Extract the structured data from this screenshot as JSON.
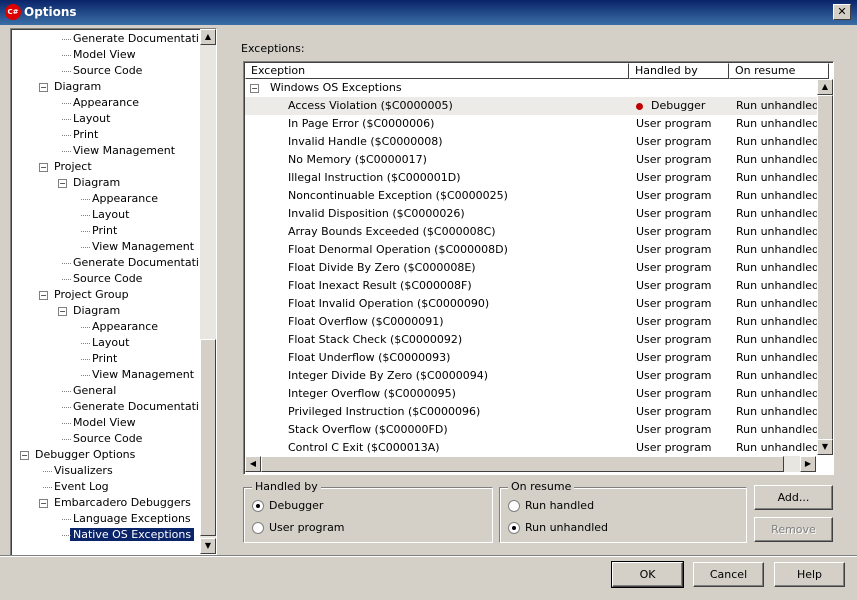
{
  "window": {
    "title": "Options",
    "app_icon_text": "C#"
  },
  "tree": {
    "items": [
      {
        "label": "Generate Documentation",
        "level": 2
      },
      {
        "label": "Model View",
        "level": 2
      },
      {
        "label": "Source Code",
        "level": 2
      },
      {
        "label": "Diagram",
        "level": 1,
        "expander": "-"
      },
      {
        "label": "Appearance",
        "level": 2
      },
      {
        "label": "Layout",
        "level": 2
      },
      {
        "label": "Print",
        "level": 2
      },
      {
        "label": "View Management",
        "level": 2
      },
      {
        "label": "Project",
        "level": 1,
        "expander": "-"
      },
      {
        "label": "Diagram",
        "level": 2,
        "expander": "-"
      },
      {
        "label": "Appearance",
        "level": 3
      },
      {
        "label": "Layout",
        "level": 3
      },
      {
        "label": "Print",
        "level": 3
      },
      {
        "label": "View Management",
        "level": 3
      },
      {
        "label": "Generate Documentation",
        "level": 2
      },
      {
        "label": "Source Code",
        "level": 2
      },
      {
        "label": "Project Group",
        "level": 1,
        "expander": "-"
      },
      {
        "label": "Diagram",
        "level": 2,
        "expander": "-"
      },
      {
        "label": "Appearance",
        "level": 3
      },
      {
        "label": "Layout",
        "level": 3
      },
      {
        "label": "Print",
        "level": 3
      },
      {
        "label": "View Management",
        "level": 3
      },
      {
        "label": "General",
        "level": 2
      },
      {
        "label": "Generate Documentation",
        "level": 2
      },
      {
        "label": "Model View",
        "level": 2
      },
      {
        "label": "Source Code",
        "level": 2
      },
      {
        "label": "Debugger Options",
        "level": 0,
        "expander": "-"
      },
      {
        "label": "Visualizers",
        "level": 1
      },
      {
        "label": "Event Log",
        "level": 1
      },
      {
        "label": "Embarcadero Debuggers",
        "level": 1,
        "expander": "-"
      },
      {
        "label": "Language Exceptions",
        "level": 2
      },
      {
        "label": "Native OS Exceptions",
        "level": 2,
        "selected": true
      }
    ]
  },
  "exceptions": {
    "label": "Exceptions:",
    "columns": [
      "Exception",
      "Handled by",
      "On resume"
    ],
    "group": "Windows OS Exceptions",
    "rows": [
      {
        "name": "Access Violation ($C0000005)",
        "handled": "Debugger",
        "resume": "Run unhandled",
        "selected": true,
        "dot": true
      },
      {
        "name": "In Page Error ($C0000006)",
        "handled": "User program",
        "resume": "Run unhandled"
      },
      {
        "name": "Invalid Handle ($C0000008)",
        "handled": "User program",
        "resume": "Run unhandled"
      },
      {
        "name": "No Memory ($C0000017)",
        "handled": "User program",
        "resume": "Run unhandled"
      },
      {
        "name": "Illegal Instruction ($C000001D)",
        "handled": "User program",
        "resume": "Run unhandled"
      },
      {
        "name": "Noncontinuable Exception ($C0000025)",
        "handled": "User program",
        "resume": "Run unhandled"
      },
      {
        "name": "Invalid Disposition ($C0000026)",
        "handled": "User program",
        "resume": "Run unhandled"
      },
      {
        "name": "Array Bounds Exceeded ($C000008C)",
        "handled": "User program",
        "resume": "Run unhandled"
      },
      {
        "name": "Float Denormal Operation ($C000008D)",
        "handled": "User program",
        "resume": "Run unhandled"
      },
      {
        "name": "Float Divide By Zero ($C000008E)",
        "handled": "User program",
        "resume": "Run unhandled"
      },
      {
        "name": "Float Inexact Result ($C000008F)",
        "handled": "User program",
        "resume": "Run unhandled"
      },
      {
        "name": "Float Invalid Operation ($C0000090)",
        "handled": "User program",
        "resume": "Run unhandled"
      },
      {
        "name": "Float Overflow ($C0000091)",
        "handled": "User program",
        "resume": "Run unhandled"
      },
      {
        "name": "Float Stack Check ($C0000092)",
        "handled": "User program",
        "resume": "Run unhandled"
      },
      {
        "name": "Float Underflow ($C0000093)",
        "handled": "User program",
        "resume": "Run unhandled"
      },
      {
        "name": "Integer Divide By Zero ($C0000094)",
        "handled": "User program",
        "resume": "Run unhandled"
      },
      {
        "name": "Integer Overflow ($C0000095)",
        "handled": "User program",
        "resume": "Run unhandled"
      },
      {
        "name": "Privileged Instruction ($C0000096)",
        "handled": "User program",
        "resume": "Run unhandled"
      },
      {
        "name": "Stack Overflow ($C00000FD)",
        "handled": "User program",
        "resume": "Run unhandled"
      },
      {
        "name": "Control C Exit ($C000013A)",
        "handled": "User program",
        "resume": "Run unhandled"
      }
    ]
  },
  "handled_by": {
    "title": "Handled by",
    "options": [
      "Debugger",
      "User program"
    ],
    "selected": "Debugger"
  },
  "on_resume": {
    "title": "On resume",
    "options": [
      "Run handled",
      "Run unhandled"
    ],
    "selected": "Run unhandled"
  },
  "buttons": {
    "add": "Add...",
    "remove": "Remove",
    "ok": "OK",
    "cancel": "Cancel",
    "help": "Help"
  },
  "colors": {
    "titlebar": "#0a246a",
    "selection": "#0a246a",
    "dot": "#c00000",
    "face": "#d4d0c8"
  }
}
